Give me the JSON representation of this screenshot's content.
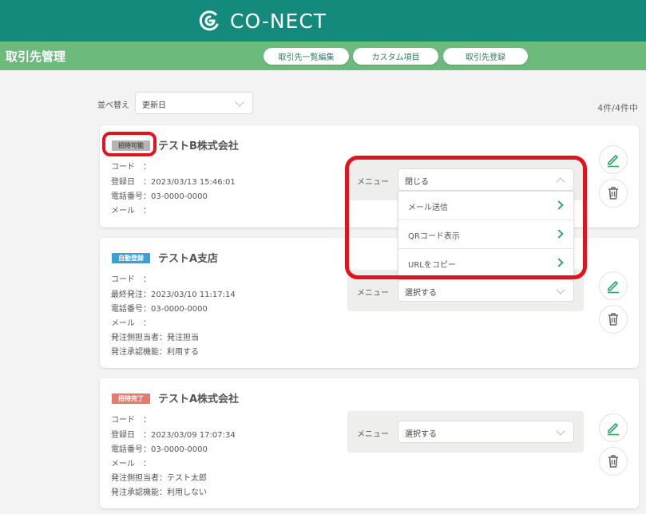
{
  "header": {
    "logo_text": "CO-NECT"
  },
  "subbar": {
    "title": "取引先管理",
    "buttons": [
      "取引先一覧編集",
      "カスタム項目",
      "取引先登録"
    ]
  },
  "sort": {
    "label": "並べ替え",
    "value": "更新日"
  },
  "count": "4件/4件中",
  "menu_label": "メニュー",
  "cards": [
    {
      "badge": "招待可能",
      "badge_color": "#b5b5b5",
      "name": "テストB株式会社",
      "fields": [
        "コード　：",
        "登録日　：2023/03/13 15:46:01",
        "電話番号：03-0000-0000",
        "メール　："
      ],
      "menu_value": "閉じる"
    },
    {
      "badge": "自動登録",
      "badge_color": "#3aa0d8",
      "name": "テストA支店",
      "fields": [
        "コード　：",
        "最終発注：2023/03/10 11:17:14",
        "電話番号：03-0000-0000",
        "メール　：",
        "発注側担当者：発注担当",
        "発注承認機能：利用する"
      ],
      "menu_value": "選択する"
    },
    {
      "badge": "招待完了",
      "badge_color": "#e57b70",
      "name": "テストA株式会社",
      "fields": [
        "コード　：",
        "登録日　：2023/03/09 17:07:34",
        "電話番号：03-0000-0000",
        "メール　：",
        "発注側担当者：テスト太郎",
        "発注承認機能：利用しない"
      ],
      "menu_value": "選択する"
    }
  ],
  "dropdown_items": [
    "メール送信",
    "QRコード表示",
    "URLをコピー"
  ],
  "colors": {
    "header": "#138a7b",
    "subbar": "#6dba7d",
    "accent": "#2ea56a",
    "highlight": "#e0141e"
  }
}
